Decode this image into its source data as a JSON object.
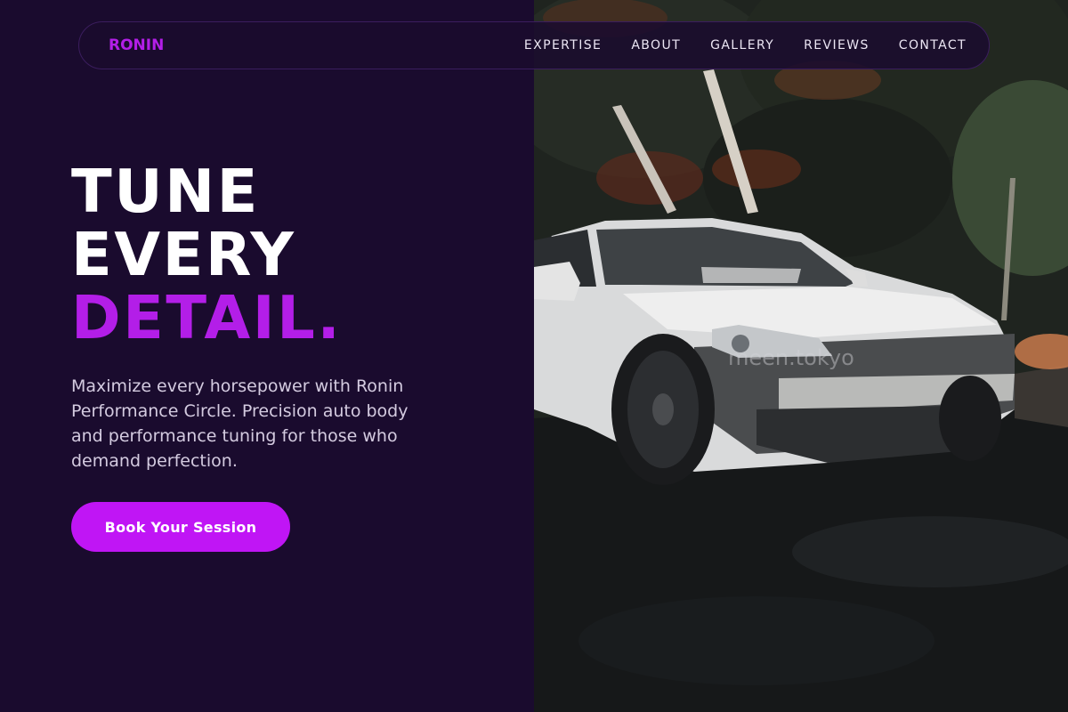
{
  "brand": {
    "name": "RONIN",
    "accent_color": "#b31ee8"
  },
  "nav": {
    "links": [
      "EXPERTISE",
      "ABOUT",
      "GALLERY",
      "REVIEWS",
      "CONTACT"
    ]
  },
  "hero": {
    "title_line1": "TUNE",
    "title_line2": "EVERY",
    "title_accent": "DETAIL.",
    "description": "Maximize every horsepower with Ronin Performance Circle. Precision auto body and performance tuning for those who demand perfection.",
    "cta_label": "Book Your Session"
  },
  "photo": {
    "subject": "white sports car with front bumper removed on wet road in forest",
    "watermark": "meen.tokyo"
  },
  "colors": {
    "background": "#1a0b2e",
    "cta": "#c015f5",
    "text_primary": "#ffffff",
    "text_secondary": "#d4cbe0"
  }
}
